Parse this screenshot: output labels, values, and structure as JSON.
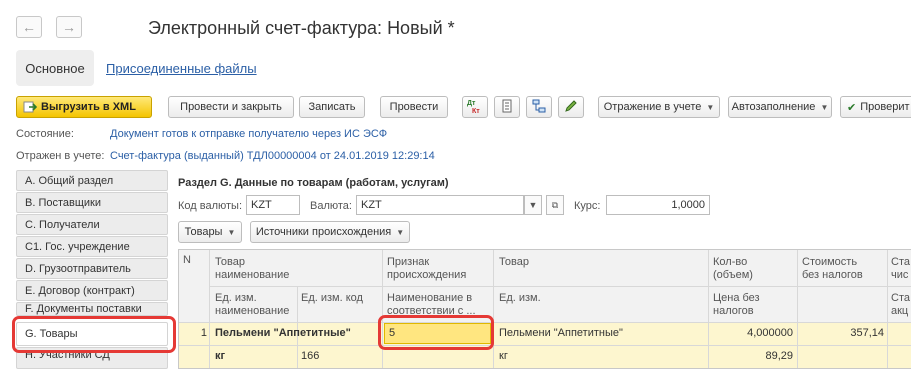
{
  "window": {
    "title": "Электронный счет-фактура: Новый *"
  },
  "nav": {
    "back_icon": "←",
    "forward_icon": "→"
  },
  "tabs": {
    "main": "Основное",
    "attached": "Присоединенные файлы"
  },
  "toolbar": {
    "export_xml": "Выгрузить в XML",
    "post_close": "Провести и закрыть",
    "save": "Записать",
    "post": "Провести",
    "reflection": "Отражение в учете",
    "autofill": "Автозаполнение",
    "check": "Проверит"
  },
  "status": {
    "state_label": "Состояние:",
    "state_value": "Документ готов к отправке получателю через ИС ЭСФ",
    "reflected_label": "Отражен в учете:",
    "reflected_value": "Счет-фактура (выданный) ТДЛ00000004 от 24.01.2019 12:29:14"
  },
  "sidebar": {
    "items": [
      {
        "label": "A. Общий раздел"
      },
      {
        "label": "B. Поставщики"
      },
      {
        "label": "C. Получатели"
      },
      {
        "label": "C1. Гос. учреждение"
      },
      {
        "label": "D. Грузоотправитель"
      },
      {
        "label": "E. Договор (контракт)"
      },
      {
        "label": "F. Документы поставки"
      },
      {
        "label": "G. Товары"
      },
      {
        "label": "H. Участники СД"
      }
    ]
  },
  "section": {
    "title": "Раздел G. Данные по товарам (работам, услугам)",
    "currency_code_label": "Код валюты:",
    "currency_code_value": "KZT",
    "currency_label": "Валюта:",
    "currency_value": "KZT",
    "rate_label": "Курс:",
    "rate_value": "1,0000",
    "goods_button": "Товары",
    "origin_sources_button": "Источники происхождения"
  },
  "table": {
    "headers": {
      "n": "N",
      "product_name_1": "Товар",
      "product_name_2": "наименование",
      "origin_1": "Признак",
      "origin_2": "происхождения",
      "product": "Товар",
      "qty_1": "Кол-во",
      "qty_2": "(объем)",
      "cost_1": "Стоимость",
      "cost_2": "без налогов",
      "rate_1": "Ста",
      "rate_2": "чис",
      "unit_name_1": "Ед. изм.",
      "unit_name_2": "наименование",
      "unit_code": "Ед. изм. код",
      "origin_name_1": "Наименование в",
      "origin_name_2": "соответствии с ...",
      "unit": "Ед. изм.",
      "price_1": "Цена без",
      "price_2": "налогов",
      "excise_1": "Ста",
      "excise_2": "акц"
    },
    "row": {
      "n": "1",
      "product_name": "Пельмени \"Аппетитные\"",
      "origin": "5",
      "product": "Пельмени \"Аппетитные\"",
      "qty": "4,000000",
      "cost": "357,14",
      "unit_name": "кг",
      "unit_code": "166",
      "unit": "кг",
      "price": "89,29"
    }
  },
  "colors": {
    "highlight": "#e53935",
    "row_bg": "#fdf6cf",
    "accent_yellow": "#f4c400",
    "link": "#2b5fa6"
  }
}
